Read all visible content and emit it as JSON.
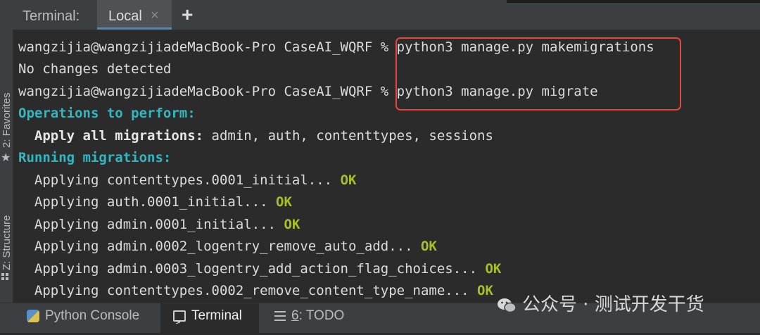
{
  "tabbar": {
    "title": "Terminal:",
    "active_tab": "Local",
    "close_glyph": "×",
    "add_glyph": "+"
  },
  "side_panel": {
    "favorites_label": "2: Favorites",
    "structure_label": "Z: Structure",
    "star_icon": "star-icon",
    "structure_icon": "structure-icon"
  },
  "terminal": {
    "lines": [
      {
        "prompt": "wangzijia@wangzijiadeMacBook-Pro CaseAI_WQRF % ",
        "command": "python3 manage.py makemigrations"
      },
      {
        "text": "No changes detected"
      },
      {
        "prompt": "wangzijia@wangzijiadeMacBook-Pro CaseAI_WQRF % ",
        "command": "python3 manage.py migrate"
      },
      {
        "heading": "Operations to perform:"
      },
      {
        "indent": "  ",
        "bold": "Apply all migrations:",
        "text": " admin, auth, contenttypes, sessions"
      },
      {
        "heading": "Running migrations:"
      },
      {
        "text": "  Applying contenttypes.0001_initial... ",
        "status": "OK"
      },
      {
        "text": "  Applying auth.0001_initial... ",
        "status": "OK"
      },
      {
        "text": "  Applying admin.0001_initial... ",
        "status": "OK"
      },
      {
        "text": "  Applying admin.0002_logentry_remove_auto_add... ",
        "status": "OK"
      },
      {
        "text": "  Applying admin.0003_logentry_add_action_flag_choices... ",
        "status": "OK"
      },
      {
        "text": "  Applying contenttypes.0002_remove_content_type_name... ",
        "status": "OK"
      }
    ]
  },
  "bottombar": {
    "python_console": "Python Console",
    "terminal": "Terminal",
    "todo_number": "6",
    "todo_label": ": TODO"
  },
  "watermark": {
    "text": "公众号 · 测试开发干货",
    "logo_icon": "wechat-logo-icon"
  },
  "colors": {
    "background": "#2b2b2b",
    "heading": "#2fb8c2",
    "ok": "#a8c023",
    "highlight_box": "#e8453c"
  }
}
